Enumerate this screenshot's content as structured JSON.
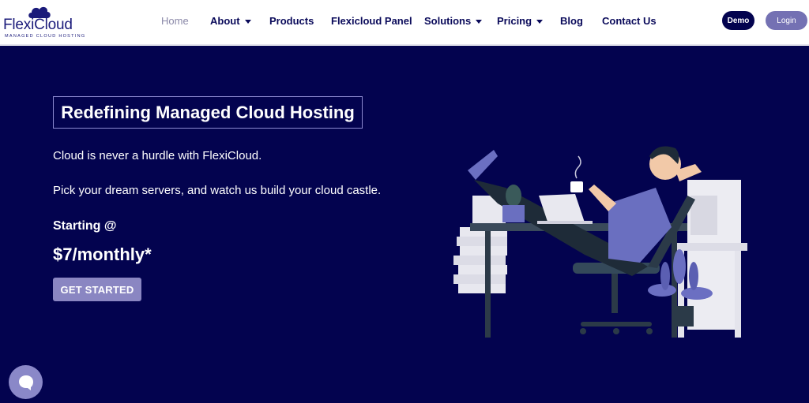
{
  "brand": {
    "name": "FlexiCloud",
    "tagline": "MANAGED CLOUD HOSTING"
  },
  "nav": {
    "items": [
      {
        "label": "Home",
        "active": true,
        "dropdown": false
      },
      {
        "label": "About",
        "active": false,
        "dropdown": true
      },
      {
        "label": "Products",
        "active": false,
        "dropdown": false
      },
      {
        "label": "Flexicloud Panel",
        "active": false,
        "dropdown": false
      },
      {
        "label": "Solutions",
        "active": false,
        "dropdown": true
      },
      {
        "label": "Pricing",
        "active": false,
        "dropdown": true
      },
      {
        "label": "Blog",
        "active": false,
        "dropdown": false
      },
      {
        "label": "Contact Us",
        "active": false,
        "dropdown": false
      }
    ],
    "demo_label": "Demo",
    "login_label": "Login"
  },
  "hero": {
    "headline": "Redefining Managed Cloud Hosting",
    "line1": "Cloud is never a hurdle with FlexiCloud.",
    "line2": "Pick your dream servers, and watch us build your cloud castle.",
    "starting_label": "Starting @",
    "price": "$7/monthly*",
    "cta_label": "GET STARTED"
  },
  "icons": {
    "logo": "cloud-icon",
    "chat": "chat-bubble-icon",
    "dropdown": "chevron-down-icon"
  },
  "colors": {
    "hero_bg": "#03034f",
    "brand_navy": "#0a0a5a",
    "accent_purple": "#8a86c2",
    "login_bg": "#7471b3"
  }
}
